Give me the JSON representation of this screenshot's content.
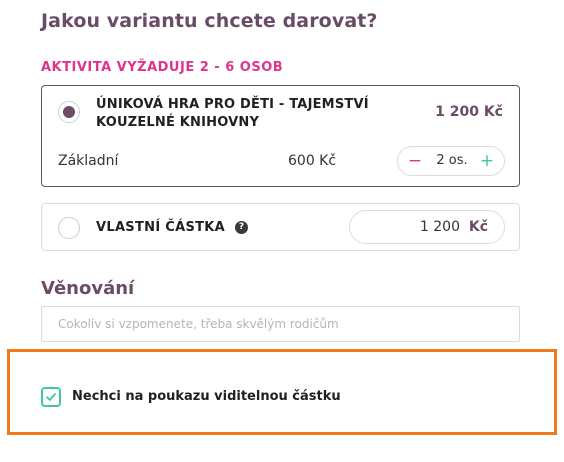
{
  "form": {
    "heading": "Jakou variantu chcete darovat?",
    "requirement": "AKTIVITA VYŽADUJE 2 - 6 OSOB"
  },
  "variant": {
    "name": "ÚNIKOVÁ HRA PRO DĚTI - TAJEMSTVÍ KOUZELNÉ KNIHOVNY",
    "total_price": "1 200 Kč",
    "base_label": "Základní",
    "unit_price": "600 Kč",
    "stepper": {
      "minus": "−",
      "count": "2 os.",
      "plus": "+"
    }
  },
  "custom_amount": {
    "label": "VLASTNÍ ČÁSTKA",
    "help_icon": "?",
    "value": "1 200",
    "currency": "Kč"
  },
  "dedication": {
    "title": "Věnování",
    "placeholder": "Cokoliv si vzpomenete, třeba skvělým rodičům",
    "value": ""
  },
  "hide_amount": {
    "label": "Nechci na poukazu viditelnou částku",
    "checked": true
  },
  "colors": {
    "accent": "#6b4c66",
    "pink": "#e0338c",
    "green": "#3fc89a",
    "highlight": "#f27a1a"
  }
}
